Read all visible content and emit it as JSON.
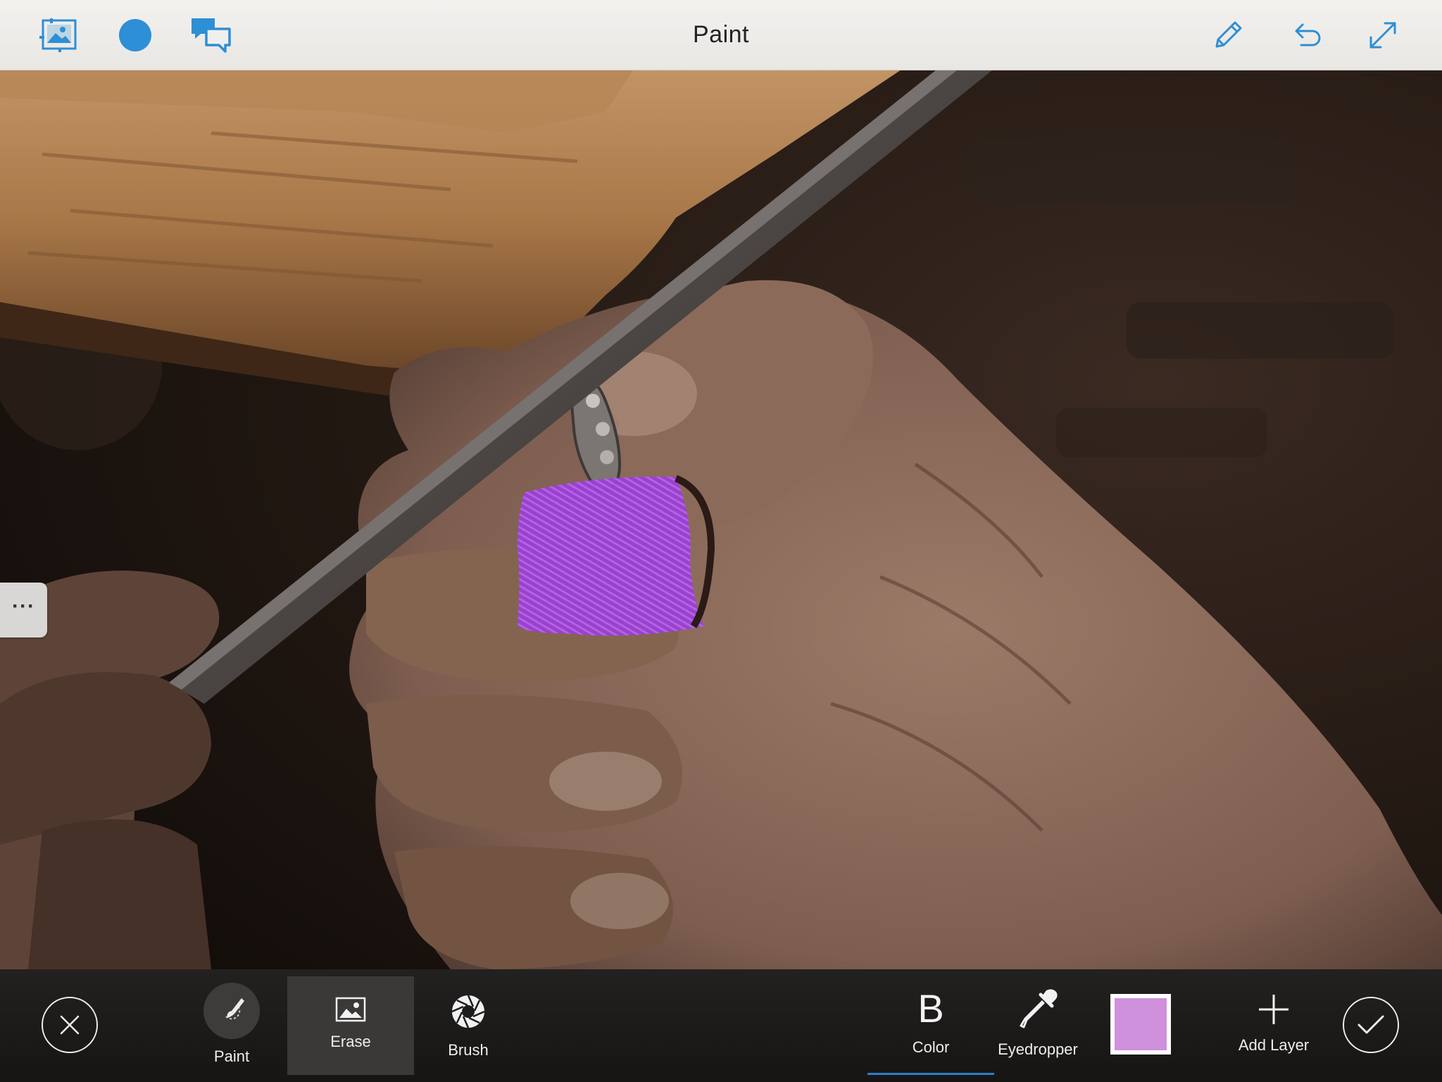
{
  "app": {
    "title": "Paint"
  },
  "top_bar": {
    "left_icons": [
      "image-layers-icon",
      "circle-icon",
      "comments-icon"
    ],
    "right_icons": [
      "pencil-icon",
      "undo-icon",
      "expand-icon"
    ]
  },
  "side_menu": {
    "label": "···"
  },
  "tools": {
    "paint": "Paint",
    "erase": "Erase",
    "brush": "Brush",
    "color": "Color",
    "color_glyph": "B",
    "eyedropper": "Eyedropper",
    "add_layer": "Add Layer"
  },
  "state": {
    "active_tool": "Erase",
    "active_option": "Color"
  },
  "colors": {
    "accent": "#2d8fd5",
    "current_paint": "#cf90dc",
    "painted_overlay": "#9d3fd6",
    "active_underline": "#2d7fc6"
  }
}
